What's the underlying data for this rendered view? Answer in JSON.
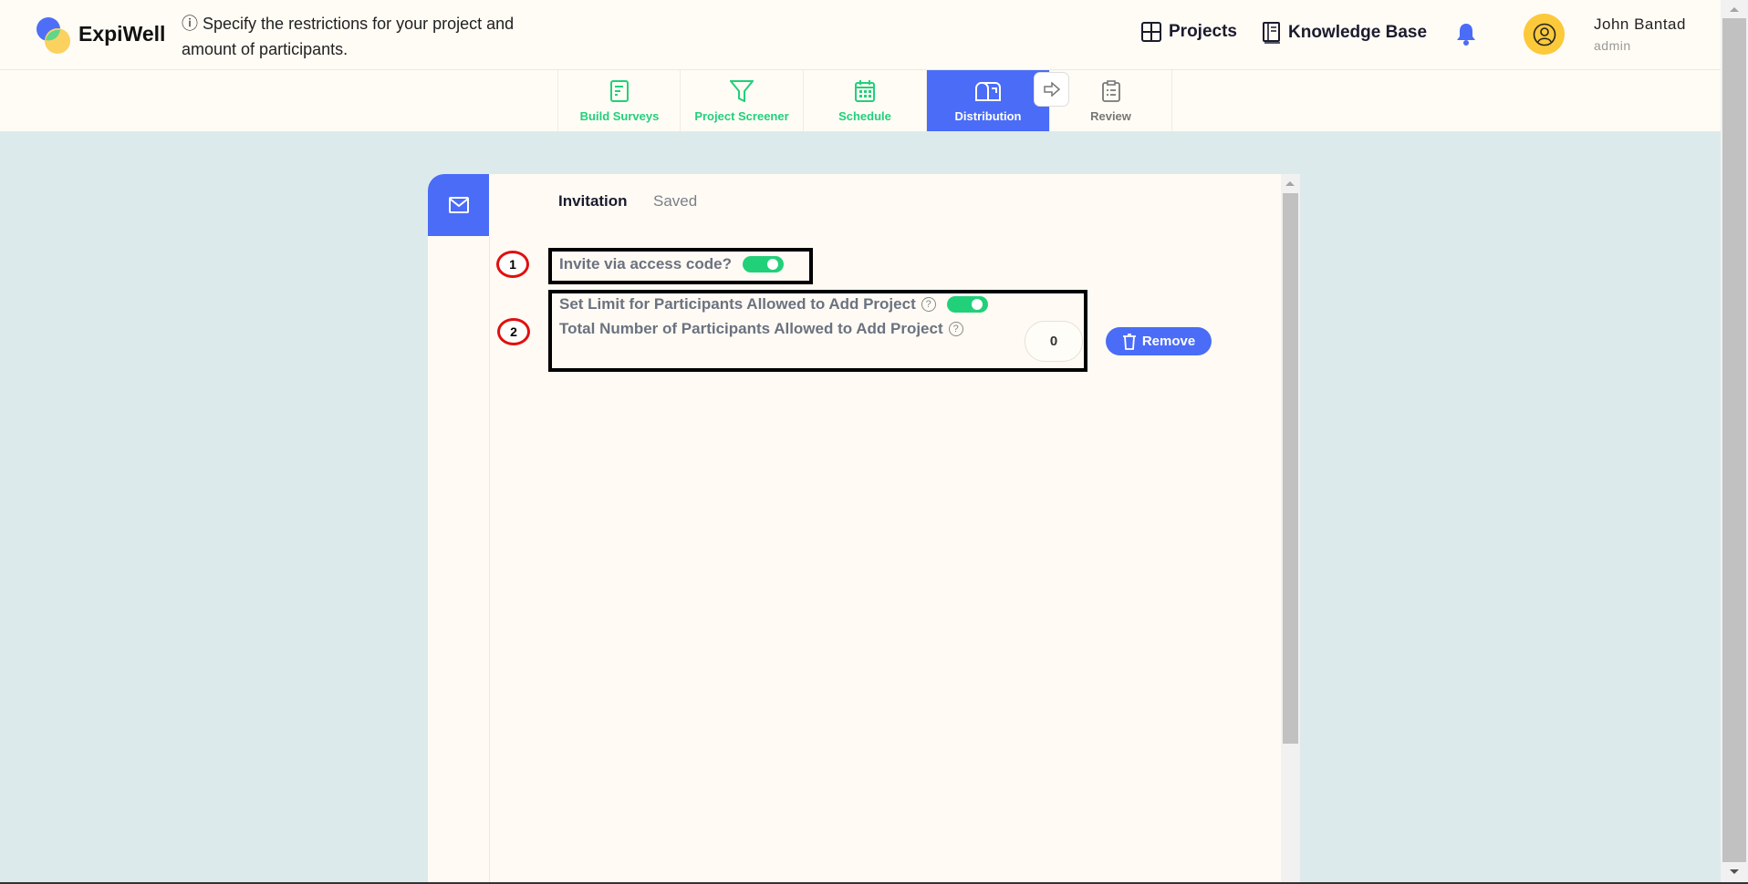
{
  "header": {
    "brand": "ExpiWell",
    "info": "Specify the restrictions for your project and amount of participants.",
    "links": [
      {
        "label": "Projects",
        "icon": "grid-icon"
      },
      {
        "label": "Knowledge Base",
        "icon": "book-icon"
      }
    ],
    "user": {
      "name": "John Bantad",
      "role": "admin"
    }
  },
  "steps": [
    {
      "label": "Build Surveys",
      "icon": "document-icon"
    },
    {
      "label": "Project Screener",
      "icon": "filter-icon"
    },
    {
      "label": "Schedule",
      "icon": "calendar-icon"
    },
    {
      "label": "Distribution",
      "icon": "mailbox-icon",
      "active": true
    },
    {
      "label": "Review",
      "icon": "clipboard-icon"
    }
  ],
  "panel": {
    "tabs": [
      "Invitation",
      "Saved"
    ],
    "annotations": [
      "1",
      "2"
    ],
    "invite_label": "Invite via access code?",
    "invite_on": true,
    "limit_label": "Set Limit for Participants Allowed to Add Project",
    "limit_on": true,
    "total_label": "Total Number of Participants Allowed to Add Project",
    "total_value": "0",
    "remove_label": "Remove"
  },
  "colors": {
    "accent": "#4a6cf7",
    "green": "#22d07a",
    "background": "#ddeaeb"
  }
}
